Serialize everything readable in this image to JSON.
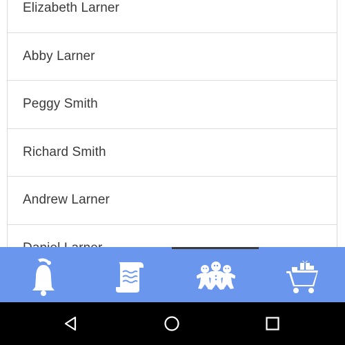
{
  "contacts": [
    {
      "name": "Elizabeth Larner"
    },
    {
      "name": "Abby Larner"
    },
    {
      "name": "Peggy Smith"
    },
    {
      "name": "Richard Smith"
    },
    {
      "name": "Andrew Larner"
    },
    {
      "name": "Daniel Larner"
    }
  ],
  "tabs": [
    {
      "icon": "bell-icon",
      "selected": false
    },
    {
      "icon": "scroll-icon",
      "selected": false
    },
    {
      "icon": "gingerbread-people-icon",
      "selected": true
    },
    {
      "icon": "gift-cart-icon",
      "selected": false
    }
  ],
  "navigation": [
    {
      "icon": "back-triangle-icon"
    },
    {
      "icon": "home-circle-icon"
    },
    {
      "icon": "recents-square-icon"
    }
  ],
  "colors": {
    "tab_bar": "#6b96ee",
    "tab_icon": "#ffffff",
    "nav_bar": "#000000",
    "text": "#3a3a3a"
  }
}
